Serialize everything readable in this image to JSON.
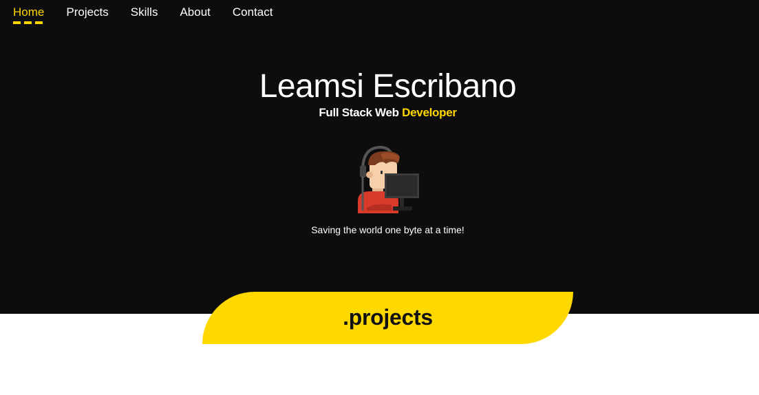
{
  "nav": {
    "items": [
      {
        "label": "Home",
        "active": true
      },
      {
        "label": "Projects",
        "active": false
      },
      {
        "label": "Skills",
        "active": false
      },
      {
        "label": "About",
        "active": false
      },
      {
        "label": "Contact",
        "active": false
      }
    ]
  },
  "hero": {
    "name": "Leamsi Escribano",
    "subtitle_prefix": "Full Stack Web ",
    "subtitle_accent": "Developer",
    "avatar_icon": "developer-at-computer-icon",
    "tagline": "Saving the world one byte at a time!"
  },
  "projects": {
    "heading": ".projects"
  },
  "colors": {
    "accent": "#ffd600",
    "hero_background": "#0d0d0d",
    "banner": "#ffd800"
  }
}
